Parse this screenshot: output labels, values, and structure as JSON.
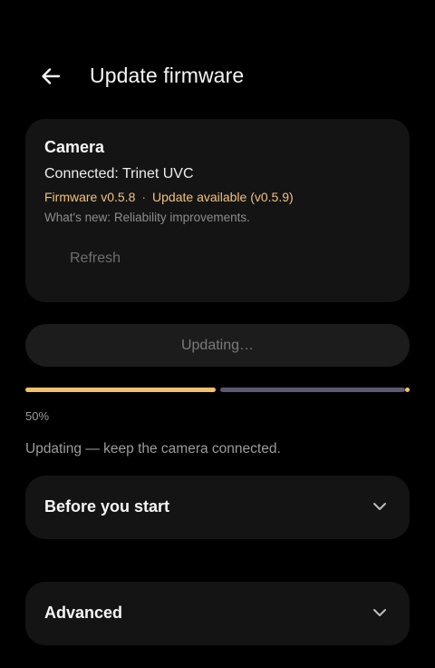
{
  "header": {
    "title": "Update firmware",
    "back_icon": "arrow-left-icon"
  },
  "device_card": {
    "heading": "Camera",
    "connected": "Connected: Trinet UVC",
    "firmware_current": "Firmware v0.5.8",
    "separator": "·",
    "update_available": "Update available (v0.5.9)",
    "whats_new": "What's new: Reliability improvements.",
    "refresh_label": "Refresh"
  },
  "update": {
    "button_label": "Updating…",
    "progress": 0.5,
    "percent_label": "50%",
    "status": "Updating — keep the camera connected."
  },
  "sections": [
    {
      "label": "Before you start",
      "icon": "chevron-down-icon"
    },
    {
      "label": "Advanced",
      "icon": "chevron-down-icon"
    }
  ],
  "colors": {
    "accent": "#f3c06e",
    "track": "#5c5870",
    "card": "#141414",
    "background": "#000000"
  }
}
